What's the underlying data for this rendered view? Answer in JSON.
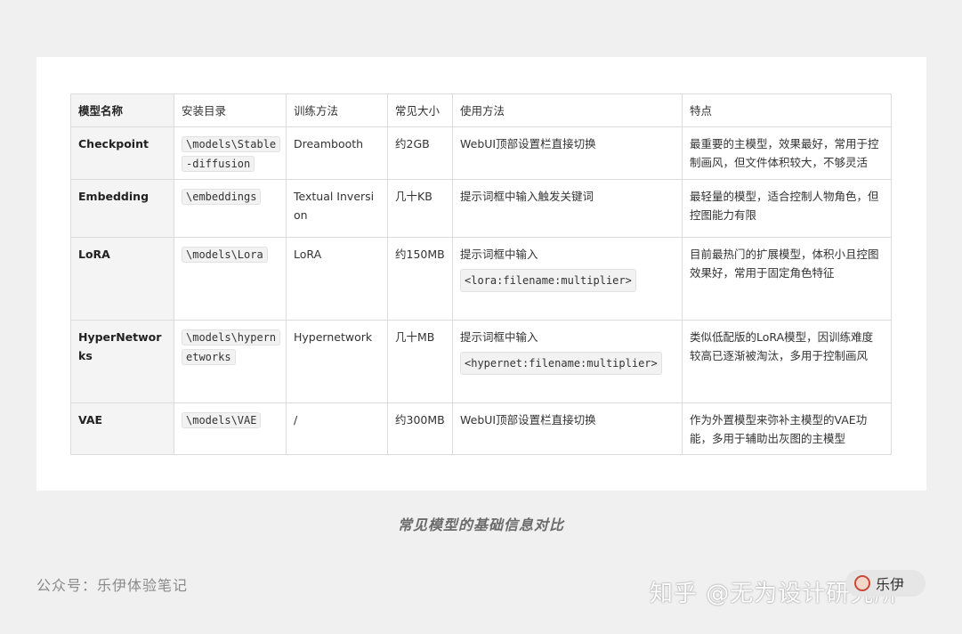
{
  "table": {
    "headers": [
      "模型名称",
      "安装目录",
      "训练方法",
      "常见大小",
      "使用方法",
      "特点"
    ],
    "rows": [
      {
        "name": "Checkpoint",
        "dir": "\\models\\Stable-diffusion",
        "method": "Dreambooth",
        "size": "约2GB",
        "usage_text": "WebUI顶部设置栏直接切换",
        "usage_code": "",
        "feature": "最重要的主模型，效果最好，常用于控制画风，但文件体积较大，不够灵活"
      },
      {
        "name": "Embedding",
        "dir": "\\embeddings",
        "method": "Textual Inversion",
        "size": "几十KB",
        "usage_text": "提示词框中输入触发关键词",
        "usage_code": "",
        "feature": "最轻量的模型，适合控制人物角色，但控图能力有限"
      },
      {
        "name": "LoRA",
        "dir": "\\models\\Lora",
        "method": "LoRA",
        "size": "约150MB",
        "usage_text": "提示词框中输入",
        "usage_code": "<lora:filename:multiplier>",
        "feature": "目前最热门的扩展模型，体积小且控图效果好，常用于固定角色特征"
      },
      {
        "name": "HyperNetworks",
        "dir": "\\models\\hypernetworks",
        "method": "Hypernetwork",
        "size": "几十MB",
        "usage_text": "提示词框中输入",
        "usage_code": "<hypernet:filename:multiplier>",
        "feature": "类似低配版的LoRA模型，因训练难度较高已逐渐被淘汰，多用于控制画风"
      },
      {
        "name": "VAE",
        "dir": "\\models\\VAE",
        "method": "/",
        "size": "约300MB",
        "usage_text": "WebUI顶部设置栏直接切换",
        "usage_code": "",
        "feature": "作为外置模型来弥补主模型的VAE功能，多用于辅助出灰图的主模型"
      }
    ]
  },
  "caption": "常见模型的基础信息对比",
  "footer": {
    "left": "公众号：乐伊体验笔记",
    "watermark": "知乎 @无为设计研究所",
    "author": "乐伊"
  }
}
